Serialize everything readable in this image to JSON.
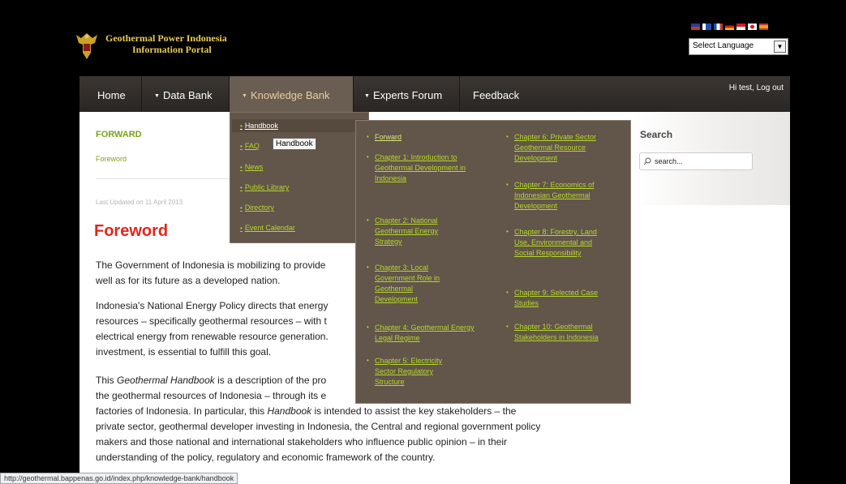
{
  "header": {
    "title_line1": "Geothermal Power Indonesia",
    "title_line2": "Information Portal",
    "language_select": "Select Language",
    "flags": [
      "#2a3b9c",
      "#c0392b",
      "#1f4fa8",
      "#f1c40f",
      "#d61f26",
      "#ffffff",
      "#e4a11b"
    ]
  },
  "nav": {
    "home": "Home",
    "data_bank": "Data Bank",
    "knowledge_bank": "Knowledge Bank",
    "experts_forum": "Experts Forum",
    "feedback": "Feedback",
    "user_prefix": "Hi test, ",
    "logout": "Log out"
  },
  "dropdown_level1": {
    "items": [
      "Handbook",
      "FAQ",
      "News",
      "Public Library",
      "Directory",
      "Event Calendar"
    ]
  },
  "tooltip": "Handbook",
  "dropdown_level2": {
    "col1": [
      "Forward",
      "Chapter 1: Introduction to Geothermal Development in Indonesia",
      "Chapter 2: National Geothermal Energy Strategy",
      "Chapter 3: Local Government Role in Geothermal Development",
      "Chapter 4: Geothermal Energy Legal Regime",
      "Chapter 5: Electricity Sector Regulatory Structure"
    ],
    "col2": [
      "Chapter 6: Private Sector Geothermal Resource Development",
      "Chapter 7: Economics of Indonesian Geothermal Development",
      "Chapter 8: Forestry, Land Use, Environmental and Social Responsibility",
      "Chapter 9: Selected Case Studies",
      "Chapter 10: Geothermal Stakeholders in Indonesia"
    ]
  },
  "content": {
    "section_title": "FORWARD",
    "section_link": "Foreword",
    "last_updated": "Last Updated on 11 April 2013",
    "heading": "Foreword",
    "p1_l1": "The Government of Indonesia is mobilizing to provide",
    "p1_l2": "well as for its future as a developed nation.",
    "p2_l1": "Indonesia's National Energy Policy directs that energy",
    "p2_l2": "resources – specifically geothermal resources – with t",
    "p2_l3": "electrical energy from renewable resource generation.",
    "p2_l4": "investment, is essential to fulfill this goal.",
    "p3_l1_a": "This ",
    "p3_l1_b": "Geothermal Handbook",
    "p3_l1_c": " is a description of the pro",
    "p3_l2": "the geothermal resources of Indonesia – through its e",
    "p3_l3_a": "factories of Indonesia. In particular, this ",
    "p3_l3_b": "Handbook",
    "p3_l3_c": " is intended to assist the key stakeholders – the",
    "p3_l4": "private sector, geothermal developer investing in Indonesia, the Central and regional government policy",
    "p3_l5": "makers and those national and international stakeholders who influence public opinion – in their",
    "p3_l6": "understanding of the policy, regulatory and economic framework of the country."
  },
  "sidebar": {
    "search_title": "Search",
    "search_placeholder": "search..."
  },
  "status_url": "http://geothermal.bappenas.go.id/index.php/knowledge-bank/handbook"
}
